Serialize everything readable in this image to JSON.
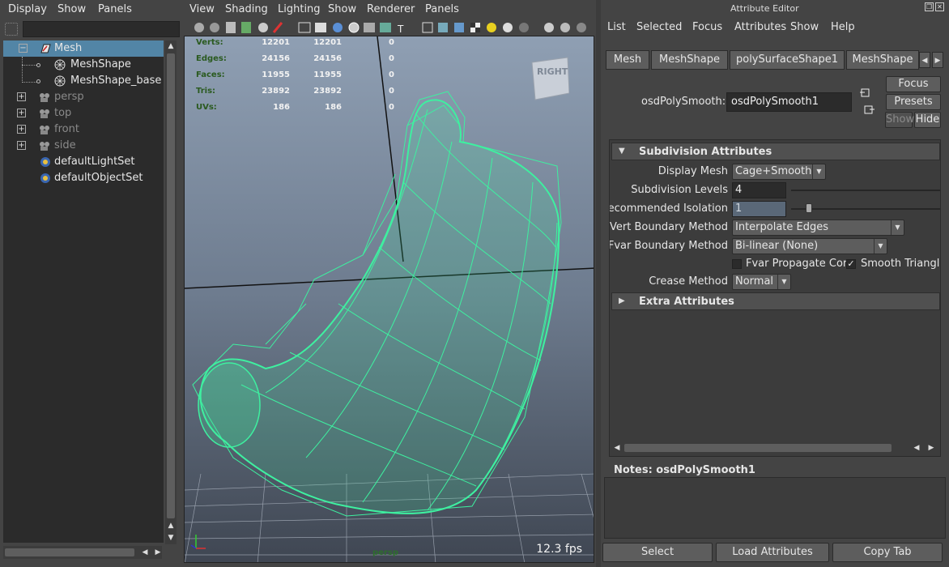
{
  "outliner": {
    "menu": [
      "Display",
      "Show",
      "Panels"
    ],
    "filter_value": "",
    "items": [
      {
        "label": "Mesh",
        "icon": "mesh-transform-icon",
        "selected": true,
        "dim": false
      },
      {
        "label": "MeshShape",
        "icon": "mesh-shape-icon",
        "dim": false
      },
      {
        "label": "MeshShape_base",
        "icon": "mesh-shape-icon",
        "dim": false
      },
      {
        "label": "persp",
        "icon": "camera-icon",
        "dim": true
      },
      {
        "label": "top",
        "icon": "camera-icon",
        "dim": true
      },
      {
        "label": "front",
        "icon": "camera-icon",
        "dim": true
      },
      {
        "label": "side",
        "icon": "camera-icon",
        "dim": true
      },
      {
        "label": "defaultLightSet",
        "icon": "set-icon",
        "dim": false
      },
      {
        "label": "defaultObjectSet",
        "icon": "set-icon",
        "dim": false
      }
    ]
  },
  "viewport": {
    "menu": [
      "View",
      "Shading",
      "Lighting",
      "Show",
      "Renderer",
      "Panels"
    ],
    "hud": [
      {
        "label": "Verts:",
        "a": "12201",
        "b": "12201",
        "c": "0"
      },
      {
        "label": "Edges:",
        "a": "24156",
        "b": "24156",
        "c": "0"
      },
      {
        "label": "Faces:",
        "a": "11955",
        "b": "11955",
        "c": "0"
      },
      {
        "label": "Tris:",
        "a": "23892",
        "b": "23892",
        "c": "0"
      },
      {
        "label": "UVs:",
        "a": "186",
        "b": "186",
        "c": "0"
      }
    ],
    "viewcube_label": "RIGHT",
    "camera_name": "persp",
    "fps": "12.3 fps",
    "wire_color": "#3ef0a0"
  },
  "attribute_editor": {
    "title": "Attribute Editor",
    "menu": [
      "List",
      "Selected",
      "Focus",
      "Attributes",
      "Show",
      "Help"
    ],
    "tabs": [
      "Mesh",
      "MeshShape",
      "polySurfaceShape1",
      "MeshShape"
    ],
    "node_label": "osdPolySmooth:",
    "node_name": "osdPolySmooth1",
    "focus_button": "Focus",
    "presets_button": "Presets",
    "show_button": "Show",
    "hide_button": "Hide",
    "section_subdivision": "Subdivision Attributes",
    "section_extra": "Extra Attributes",
    "fields": {
      "display_mesh_label": "Display Mesh",
      "display_mesh_value": "Cage+Smooth",
      "subdivision_levels_label": "Subdivision Levels",
      "subdivision_levels_value": "4",
      "recommended_isolation_label": "Recommended Isolation",
      "recommended_isolation_value": "1",
      "recommended_isolation_slider": 0.12,
      "vert_boundary_label": "Vert Boundary Method",
      "vert_boundary_value": "Interpolate Edges",
      "fvar_boundary_label": "Fvar Boundary Method",
      "fvar_boundary_value": "Bi-linear (None)",
      "fvar_propagate_label": "Fvar Propagate Cor",
      "fvar_propagate_checked": false,
      "smooth_triangles_label": "Smooth Triangle",
      "smooth_triangles_checked": true,
      "crease_method_label": "Crease Method",
      "crease_method_value": "Normal"
    },
    "notes_label": "Notes:  osdPolySmooth1",
    "bottom_buttons": [
      "Select",
      "Load Attributes",
      "Copy Tab"
    ],
    "selection_color": "#5285a6"
  }
}
